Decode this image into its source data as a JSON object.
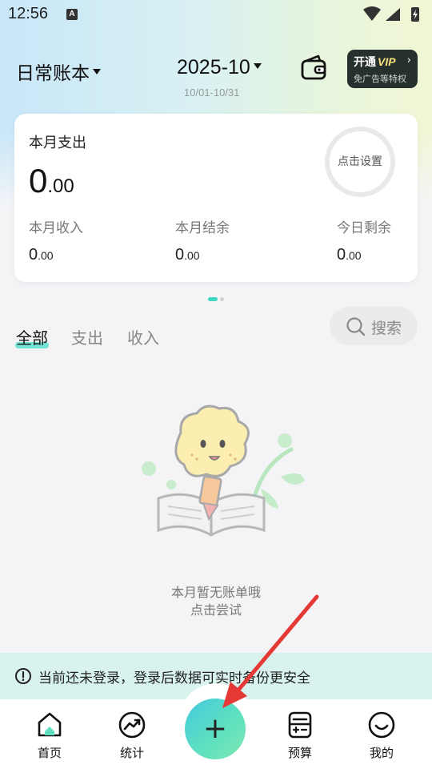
{
  "status_bar": {
    "time": "12:56",
    "notification_icon_letter": "A"
  },
  "header": {
    "ledger_name": "日常账本",
    "month": "2025-10",
    "date_range": "10/01-10/31",
    "vip": {
      "title": "开通",
      "brand": "VIP",
      "arrow": "›",
      "subtitle": "免广告等特权"
    }
  },
  "summary_card": {
    "title": "本月支出",
    "expense_int": "0",
    "expense_dec": ".00",
    "budget_ring_label": "点击设置",
    "stats": [
      {
        "label": "本月收入",
        "int": "0",
        "dec": ".00"
      },
      {
        "label": "本月结余",
        "int": "0",
        "dec": ".00"
      },
      {
        "label": "今日剩余",
        "int": "0",
        "dec": ".00"
      }
    ]
  },
  "filter_tabs": [
    "全部",
    "支出",
    "收入"
  ],
  "search": {
    "label": "搜索"
  },
  "empty_state": {
    "line1": "本月暂无账单哦",
    "line2": "点击尝试"
  },
  "notice": {
    "text": "当前还未登录，登录后数据可实时备份更安全"
  },
  "bottom_nav": {
    "items": [
      {
        "label": "首页",
        "icon": "home-icon"
      },
      {
        "label": "统计",
        "icon": "trend-icon"
      },
      {
        "label": "预算",
        "icon": "budget-icon"
      },
      {
        "label": "我的",
        "icon": "smile-icon"
      }
    ],
    "add_symbol": "+"
  },
  "colors": {
    "accent": "#5ee0c0",
    "annotation_arrow": "#e53935",
    "vip_bg": "#26312d"
  }
}
